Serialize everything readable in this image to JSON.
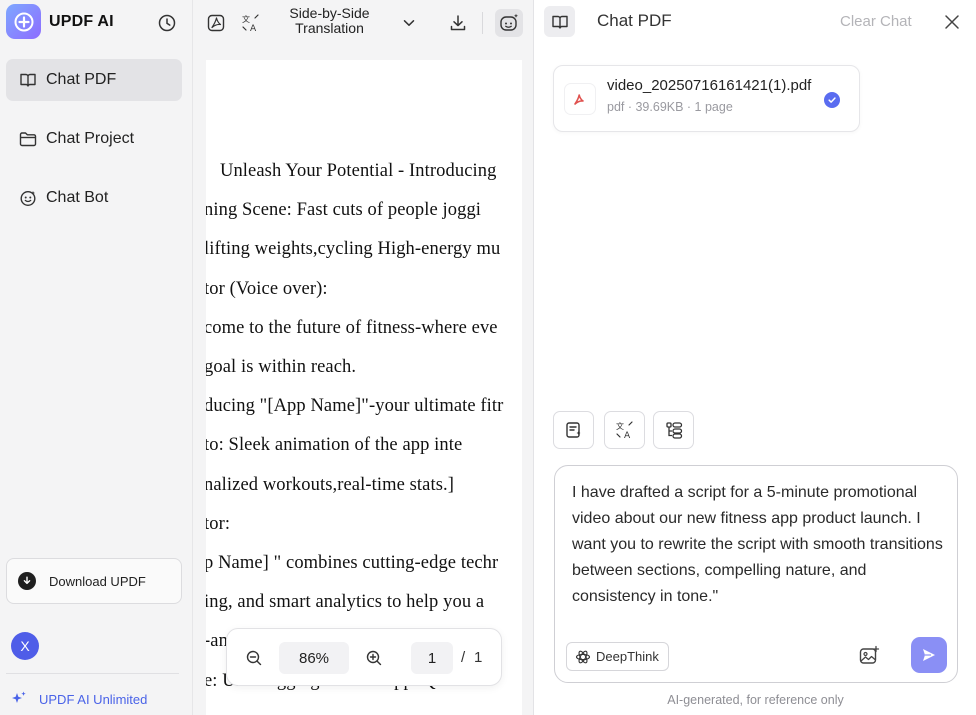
{
  "sidebar": {
    "app_name": "UPDF AI",
    "nav_items": [
      {
        "label": "Chat PDF",
        "icon": "book-open-icon",
        "active": true
      },
      {
        "label": "Chat Project",
        "icon": "folder-icon",
        "active": false
      },
      {
        "label": "Chat Bot",
        "icon": "bot-icon",
        "active": false
      }
    ],
    "download_label": "Download UPDF",
    "avatar_initial": "X",
    "unlimited_label": "UPDF AI Unlimited"
  },
  "doc_toolbar": {
    "translate_label": "Side-by-Side Translation"
  },
  "document": {
    "lines": [
      "Unleash Your Potential - Introducing",
      "ning Scene: Fast cuts of people joggi",
      "lifting weights,cycling High-energy mu",
      "tor (Voice over):",
      "come to the future of fitness-where eve",
      " goal is within reach.",
      "ducing \"[App Name]\"-your ultimate fitr",
      "to: Sleek animation of the app inte",
      "nalized workouts,real-time stats.]",
      "tor:",
      "p Name] \" combines cutting-edge techr",
      "ing, and smart analytics to help you a",
      "-an",
      "e: User logging into the app. Quic"
    ]
  },
  "zoom_bar": {
    "zoom": "86%",
    "page_current": "1",
    "page_separator": "/",
    "page_total": "1"
  },
  "chat": {
    "title": "Chat PDF",
    "clear_label": "Clear Chat",
    "file": {
      "name": "video_20250716161421(1).pdf",
      "meta": "pdf · 39.69KB · 1 page"
    },
    "prompt": "I have drafted a script for a 5-minute promotional video about our new fitness app product launch. I want you to rewrite the script with smooth transitions between sections, compelling nature, and consistency in tone.\"",
    "deepthink_label": "DeepThink",
    "disclaimer": "AI-generated, for reference only"
  },
  "colors": {
    "accent": "#5a6cf0",
    "send_button": "#8a8ff5",
    "unlimited_text": "#4a63e8",
    "avatar": "#4f5de8"
  }
}
